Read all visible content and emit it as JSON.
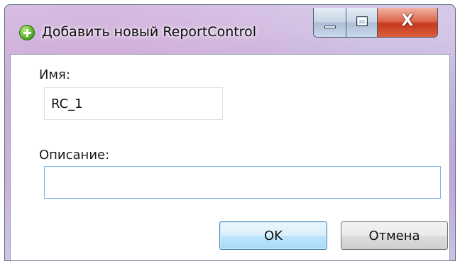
{
  "window": {
    "title": "Добавить новый ReportControl",
    "app_icon": "green-plus-icon",
    "caption": {
      "minimize_icon": "minimize-icon",
      "maximize_icon": "maximize-icon",
      "close_glyph": "X"
    }
  },
  "form": {
    "name_label": "Имя:",
    "name_value": "RC_1",
    "description_label": "Описание:",
    "description_value": ""
  },
  "buttons": {
    "ok_label": "OK",
    "cancel_label": "Отмена"
  },
  "colors": {
    "focus_border": "#7eb4ea",
    "default_button_border": "#3c7fb1",
    "close_button": "#c8391c",
    "app_icon": "#4aa51c"
  }
}
